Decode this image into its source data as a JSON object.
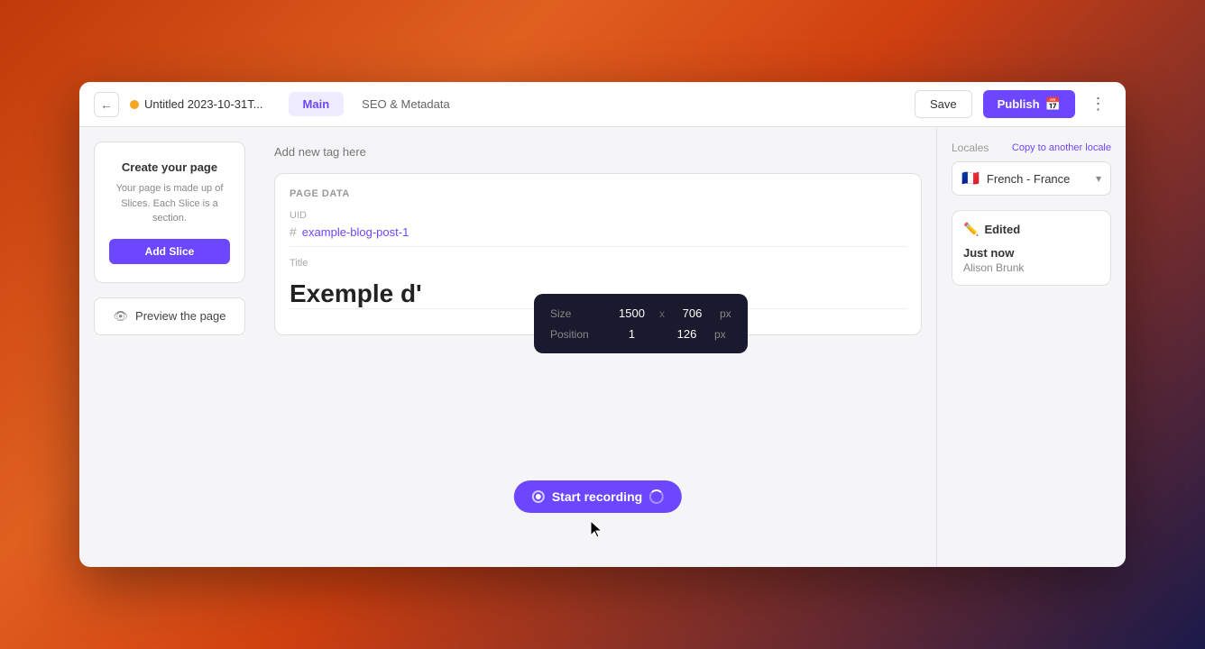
{
  "header": {
    "back_label": "←",
    "doc_title": "Untitled 2023-10-31T...",
    "tabs": [
      {
        "id": "main",
        "label": "Main",
        "active": true
      },
      {
        "id": "seo",
        "label": "SEO & Metadata",
        "active": false
      }
    ],
    "save_label": "Save",
    "publish_label": "Publish",
    "more_label": "⋮"
  },
  "left_sidebar": {
    "create_page_title": "Create your page",
    "create_page_desc": "Your page is made up of Slices.\nEach Slice is a section.",
    "add_slice_label": "Add Slice",
    "preview_label": "Preview the page"
  },
  "center": {
    "tag_placeholder": "Add new tag here",
    "page_data_label": "Page data",
    "uid_label": "UID",
    "uid_value": "example-blog-post-1",
    "title_label": "Title",
    "title_value": "Exemple d'",
    "tooltip": {
      "size_label": "Size",
      "width": "1500",
      "x_label": "x",
      "height": "706",
      "px_label": "px",
      "position_label": "Position",
      "pos_x": "1",
      "pos_y": "126",
      "px_label2": "px"
    },
    "recording_label": "Start recording"
  },
  "right_sidebar": {
    "locales_label": "Locales",
    "copy_label": "Copy to another locale",
    "locale_flag": "🇫🇷",
    "locale_name": "French - France",
    "edited_label": "Edited",
    "edited_time": "Just now",
    "edited_user": "Alison Brunk"
  }
}
